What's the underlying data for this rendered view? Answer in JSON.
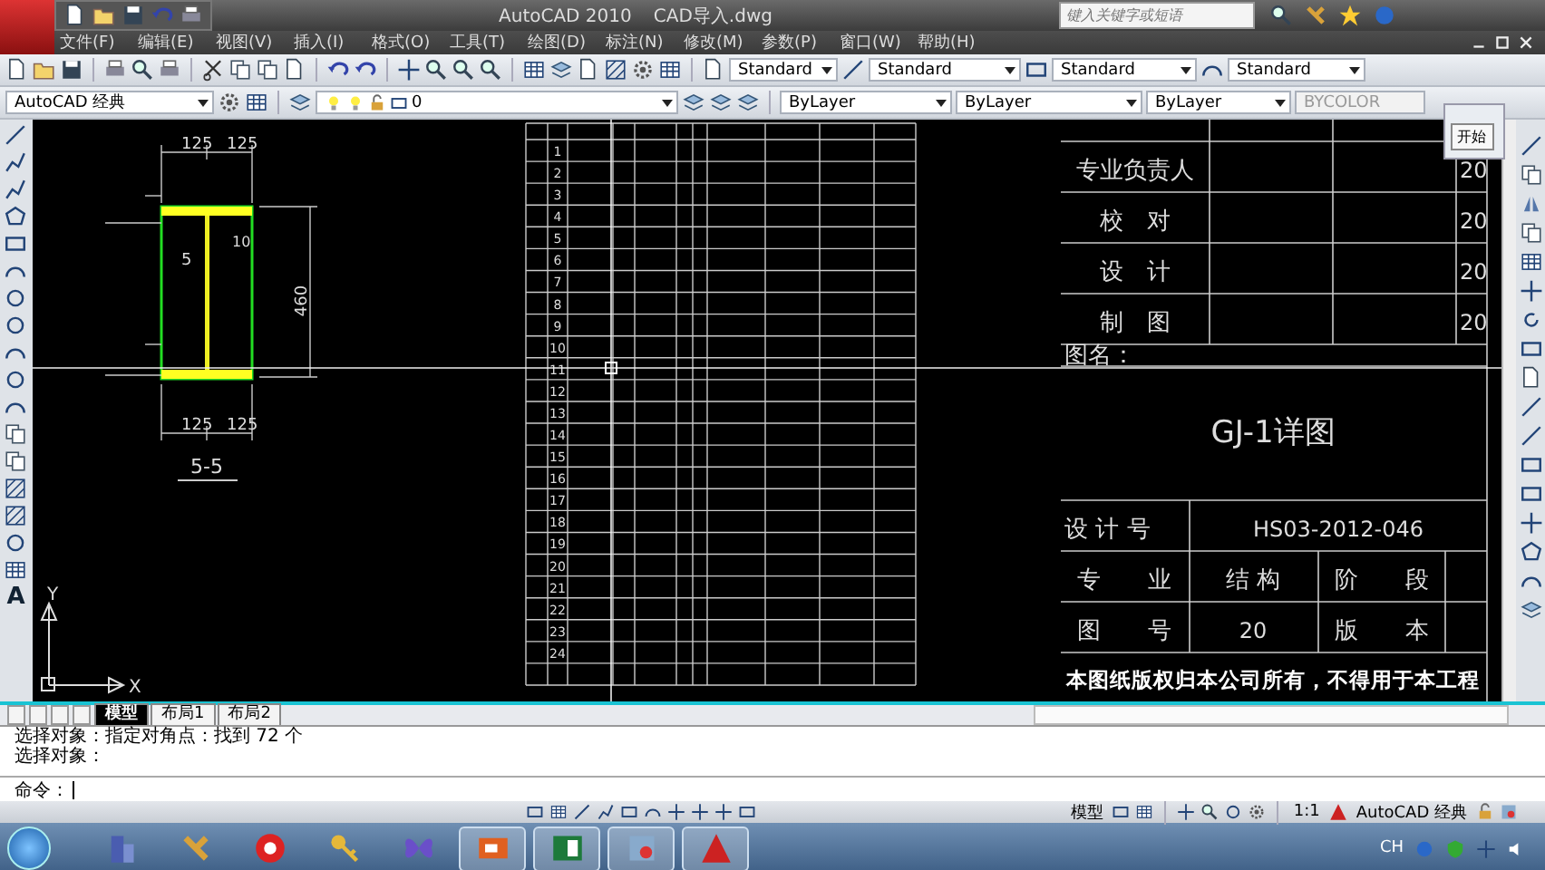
{
  "title_bar": {
    "app": "AutoCAD 2010",
    "file": "CAD导入.dwg",
    "search": {
      "placeholder": "键入关键字或短语"
    }
  },
  "menu": [
    "文件(F)",
    "编辑(E)",
    "视图(V)",
    "插入(I)",
    "格式(O)",
    "工具(T)",
    "绘图(D)",
    "标注(N)",
    "修改(M)",
    "参数(P)",
    "窗口(W)",
    "帮助(H)"
  ],
  "style_dropdowns": [
    "Standard",
    "Standard",
    "Standard",
    "Standard"
  ],
  "workspace": "AutoCAD 经典",
  "layer": "0",
  "properties": [
    {
      "value": "ByLayer",
      "disabled": false
    },
    {
      "value": "ByLayer",
      "disabled": false
    },
    {
      "value": "ByLayer",
      "disabled": false
    },
    {
      "value": "BYCOLOR",
      "disabled": true
    }
  ],
  "left_tools_text": "A",
  "drawing": {
    "section": "5-5",
    "top_dims": [
      "125",
      "125"
    ],
    "bottom_dims": [
      "125",
      "125"
    ],
    "height_dim": "460",
    "marks": [
      "5",
      "10"
    ],
    "axes": [
      "Y",
      "X"
    ]
  },
  "table": {
    "rows": [
      "1",
      "2",
      "3",
      "4",
      "5",
      "6",
      "7",
      "8",
      "9",
      "10",
      "11",
      "12",
      "13",
      "14",
      "15",
      "16",
      "17",
      "18",
      "19",
      "20",
      "21",
      "22",
      "23",
      "24"
    ]
  },
  "title_block": {
    "signers": [
      {
        "label": "专业负责人",
        "date": "20"
      },
      {
        "label": "校　对",
        "date": "20"
      },
      {
        "label": "设　计",
        "date": "20"
      },
      {
        "label": "制　图",
        "date": "20"
      }
    ],
    "name_label": "图名：",
    "drawing_name": "GJ-1详图",
    "design_no_label": "设 计 号",
    "design_no": "HS03-2012-046",
    "discipline_label": "专　　业",
    "discipline": "结 构",
    "stage_label": "阶　　段",
    "sheet_label": "图　　号",
    "sheet": "20",
    "version_label": "版　　本",
    "copyright": "本图纸版权归本公司所有，不得用于本工程"
  },
  "popup": {
    "button": "开始"
  },
  "layout_tabs": [
    {
      "label": "模型",
      "selected": true
    },
    {
      "label": "布局1",
      "selected": false
    },
    {
      "label": "布局2",
      "selected": false
    }
  ],
  "command_history": [
    "选择对象：指定对角点：找到 72 个",
    "选择对象："
  ],
  "command_prompt": "命令：",
  "status_bar": {
    "mode": "模型",
    "scale": "1:1",
    "workspace": "AutoCAD 经典"
  },
  "taskbar": {
    "apps": [
      {
        "kind": "building",
        "running": false
      },
      {
        "kind": "tools",
        "running": false
      },
      {
        "kind": "disc",
        "running": false
      },
      {
        "kind": "key",
        "running": false
      },
      {
        "kind": "butterfly",
        "running": false
      },
      {
        "kind": "slides",
        "running": true
      },
      {
        "kind": "sheet",
        "running": true
      },
      {
        "kind": "paint",
        "running": true
      },
      {
        "kind": "cad",
        "running": true
      }
    ],
    "language": "CH"
  }
}
